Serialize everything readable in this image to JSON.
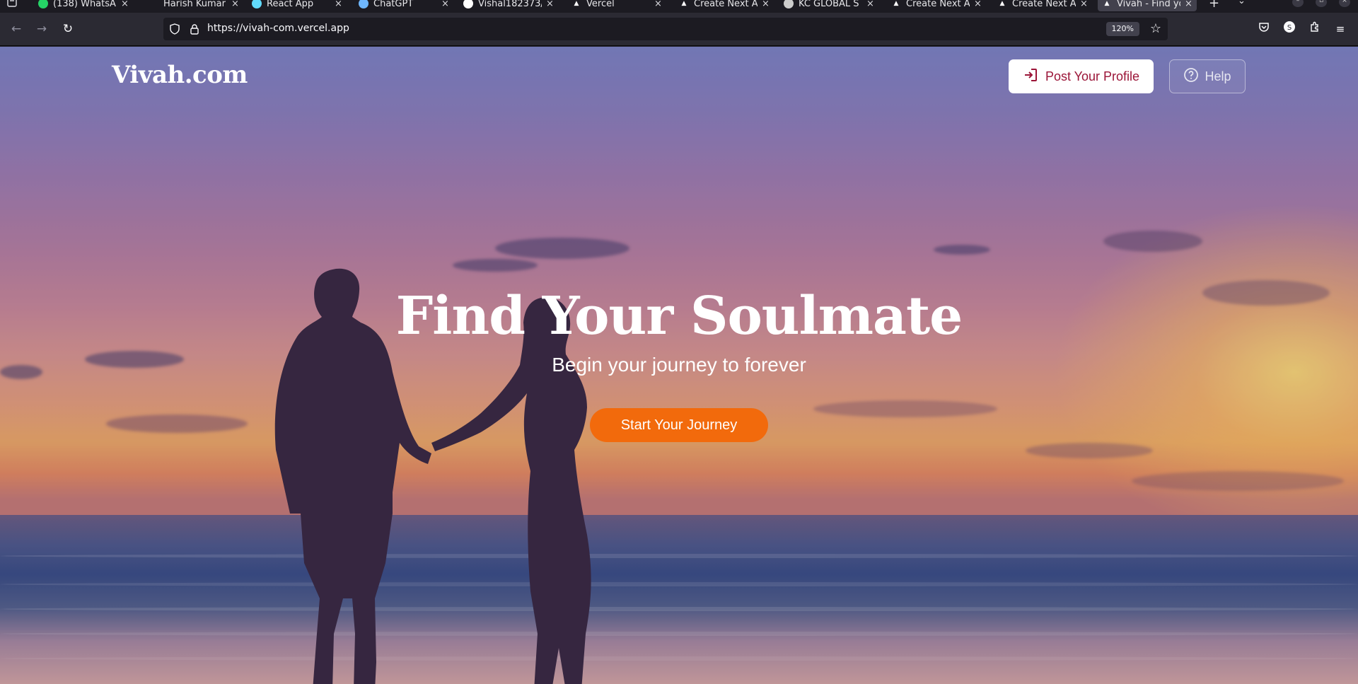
{
  "browser": {
    "tabs": [
      {
        "label": "(138) WhatsA",
        "favicon": "whatsapp-icon",
        "color": "#25d366"
      },
      {
        "label": "Harish Kumar",
        "favicon": "blank-icon",
        "color": ""
      },
      {
        "label": "React App",
        "favicon": "react-icon",
        "color": "#61dafb"
      },
      {
        "label": "ChatGPT",
        "favicon": "dot-icon",
        "color": "#6fb7ff"
      },
      {
        "label": "Vishal182373/",
        "favicon": "github-icon",
        "color": "#ffffff"
      },
      {
        "label": "Vercel",
        "favicon": "vercel-icon",
        "color": "#ffffff"
      },
      {
        "label": "Create Next A",
        "favicon": "vercel-icon",
        "color": "#ffffff"
      },
      {
        "label": "KC GLOBAL S",
        "favicon": "kc-icon",
        "color": "#cccccc"
      },
      {
        "label": "Create Next A",
        "favicon": "vercel-icon",
        "color": "#ffffff"
      },
      {
        "label": "Create Next A",
        "favicon": "vercel-icon",
        "color": "#ffffff"
      },
      {
        "label": "Vivah - Find yo",
        "favicon": "vercel-icon",
        "color": "#ffffff",
        "active": true
      }
    ],
    "url": "https://vivah-com.vercel.app",
    "zoom": "120%"
  },
  "site": {
    "logo": "Vivah.com",
    "post_profile_label": "Post Your Profile",
    "help_label": "Help"
  },
  "hero": {
    "title": "Find Your Soulmate",
    "subtitle": "Begin your journey to forever",
    "cta_label": "Start Your Journey"
  },
  "colors": {
    "accent": "#f26a0c",
    "brand_text": "#9b1538"
  }
}
